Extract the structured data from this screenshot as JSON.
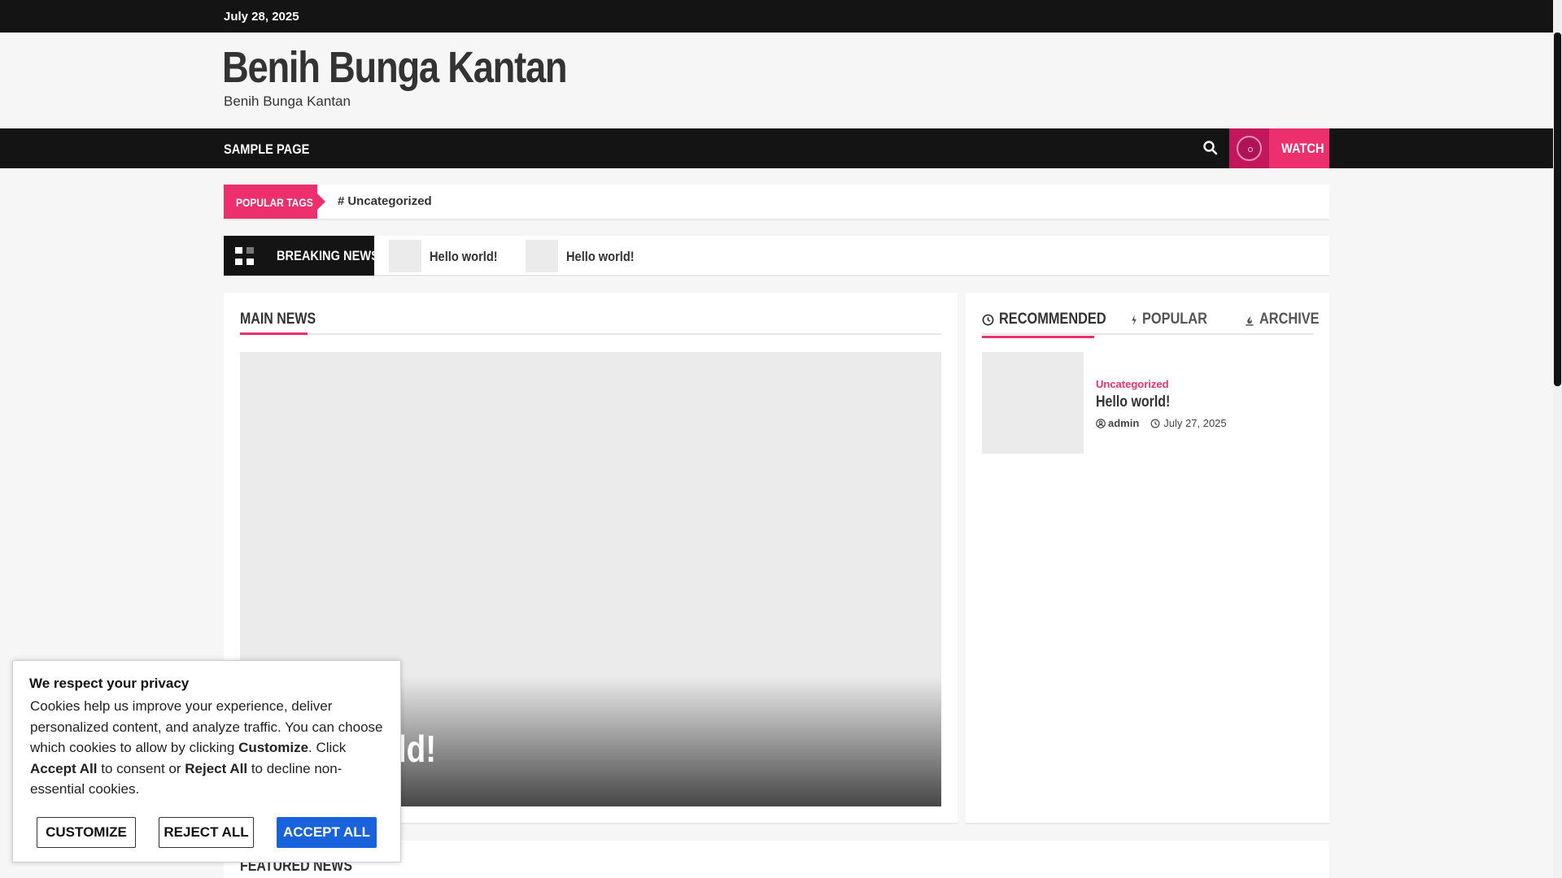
{
  "topbar": {
    "date": "July 28, 2025"
  },
  "header": {
    "site_title": "Benih Bunga Kantan",
    "tagline": "Benih Bunga Kantan"
  },
  "nav": {
    "items": [
      {
        "label": "SAMPLE PAGE"
      }
    ],
    "watch_label": "WATCH",
    "search_icon": "search-icon",
    "watch_icon": "play-circle-icon"
  },
  "popular_tags": {
    "label": "POPULAR TAGS",
    "tags": [
      {
        "hash": "#",
        "name": "Uncategorized"
      }
    ]
  },
  "breaking_news": {
    "label": "BREAKING NEWS",
    "items": [
      {
        "title": "Hello world!"
      },
      {
        "title": "Hello world!"
      }
    ]
  },
  "main_news": {
    "heading": "MAIN NEWS",
    "hero_title": "Hello world!"
  },
  "sidebar": {
    "tabs": [
      {
        "label": "RECOMMENDED",
        "icon": "clock-icon",
        "active": true
      },
      {
        "label": "POPULAR",
        "icon": "bolt-icon",
        "active": false
      },
      {
        "label": "ARCHIVE",
        "icon": "fire-icon",
        "active": false
      }
    ],
    "items": [
      {
        "category": "Uncategorized",
        "title": "Hello world!",
        "author": "admin",
        "date": "July 27, 2025"
      }
    ]
  },
  "featured_news": {
    "heading": "FEATURED NEWS"
  },
  "cookie_banner": {
    "title": "We respect your privacy",
    "text_1": "Cookies help us improve your experience, deliver personalized content, and analyze traffic. You can choose which cookies to allow by clicking ",
    "bold_customize": "Customize",
    "text_2": ". Click ",
    "bold_accept": "Accept All",
    "text_3": " to consent or ",
    "bold_reject": "Reject All",
    "text_4": " to decline non-essential cookies.",
    "customize_label": "CUSTOMIZE",
    "reject_label": "REJECT ALL",
    "accept_label": "ACCEPT ALL"
  },
  "colors": {
    "accent": "#ee2f6e",
    "dark": "#141414",
    "button_primary": "#1863dc"
  }
}
